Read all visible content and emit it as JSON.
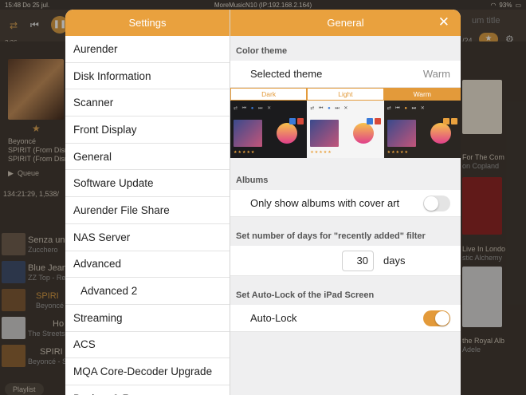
{
  "status_bar": {
    "time": "15:48",
    "date": "Do 25 jul.",
    "device": "MoreMusicN10 (IP:192.168.2.164)",
    "battery": "93%"
  },
  "background": {
    "time_elapsed": "3:36",
    "artist": "Beyoncé",
    "album_line1": "SPIRIT (From Disney",
    "album_line2": "SPIRIT (From Disney",
    "queue_label": "Queue",
    "queue_stats": "134:21:29, 1,538/",
    "tracks": [
      {
        "title": "Senza un",
        "artist": "Zucchero"
      },
      {
        "title": "Blue Jean",
        "artist": "ZZ Top - Re"
      },
      {
        "title": "SPIRI",
        "artist": "Beyoncé"
      },
      {
        "title": "Ho",
        "artist": "The Streets"
      },
      {
        "title": "SPIRI",
        "artist": "Beyoncé - S"
      }
    ],
    "playlist_button": "Playlist",
    "search_placeholder": "um title",
    "right_page": "/24",
    "right_items": [
      {
        "title": "For The Com",
        "artist": "on Copland"
      },
      {
        "title": "Live In Londo",
        "artist": "stic Alchemy"
      },
      {
        "title": "the Royal Alb",
        "artist": "Adele"
      }
    ]
  },
  "settings": {
    "title": "Settings",
    "menu": [
      {
        "label": "Aurender",
        "sub": false
      },
      {
        "label": "Disk Information",
        "sub": false
      },
      {
        "label": "Scanner",
        "sub": false
      },
      {
        "label": "Front Display",
        "sub": false
      },
      {
        "label": "General",
        "sub": false
      },
      {
        "label": "Software Update",
        "sub": false
      },
      {
        "label": "Aurender File Share",
        "sub": false
      },
      {
        "label": "NAS Server",
        "sub": false
      },
      {
        "label": "Advanced",
        "sub": false
      },
      {
        "label": "Advanced 2",
        "sub": true
      },
      {
        "label": "Streaming",
        "sub": false
      },
      {
        "label": "ACS",
        "sub": false
      },
      {
        "label": "MQA Core-Decoder Upgrade",
        "sub": false
      },
      {
        "label": "Backup & Restore",
        "sub": false
      }
    ]
  },
  "general": {
    "title": "General",
    "color_theme": {
      "section": "Color theme",
      "selected_label": "Selected theme",
      "selected_value": "Warm",
      "options": [
        "Dark",
        "Light",
        "Warm"
      ]
    },
    "albums": {
      "section": "Albums",
      "cover_art_label": "Only show albums with cover art",
      "cover_art_enabled": false
    },
    "recently_added": {
      "section": "Set number of days for \"recently added\" filter",
      "days_value": "30",
      "days_unit": "days"
    },
    "auto_lock": {
      "section": "Set Auto-Lock of the iPad Screen",
      "label": "Auto-Lock",
      "enabled": true
    }
  },
  "colors": {
    "accent": "#e9a13e",
    "toggle_on": "#e39a3a",
    "toggle_off": "#e4e4e4"
  }
}
